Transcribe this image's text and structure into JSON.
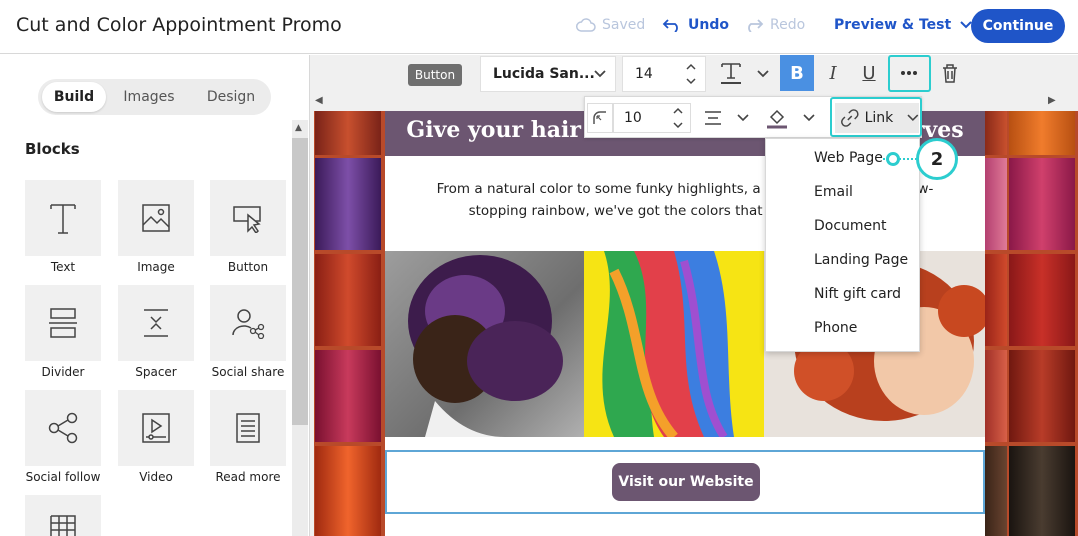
{
  "header": {
    "title": "Cut and Color Appointment Promo",
    "saved_label": "Saved",
    "undo_label": "Undo",
    "redo_label": "Redo",
    "preview_label": "Preview & Test",
    "continue_label": "Continue"
  },
  "left_panel": {
    "tabs": [
      {
        "label": "Build",
        "active": true
      },
      {
        "label": "Images",
        "active": false
      },
      {
        "label": "Design",
        "active": false
      }
    ],
    "blocks_title": "Blocks",
    "blocks": [
      {
        "label": "Text",
        "icon": "text-icon"
      },
      {
        "label": "Image",
        "icon": "image-icon"
      },
      {
        "label": "Button",
        "icon": "button-icon"
      },
      {
        "label": "Divider",
        "icon": "divider-icon"
      },
      {
        "label": "Spacer",
        "icon": "spacer-icon"
      },
      {
        "label": "Social share",
        "icon": "social-share-icon"
      },
      {
        "label": "Social follow",
        "icon": "social-follow-icon"
      },
      {
        "label": "Video",
        "icon": "video-icon"
      },
      {
        "label": "Read more",
        "icon": "read-more-icon"
      },
      {
        "label": "",
        "icon": "table-icon"
      }
    ]
  },
  "toolbar": {
    "element_type": "Button",
    "font": "Lucida San...",
    "font_size": "14"
  },
  "toolbar2": {
    "padding": "10",
    "link_label": "Link"
  },
  "link_menu": {
    "items": [
      "Web Page",
      "Email",
      "Document",
      "Landing Page",
      "Nift gift card",
      "Phone"
    ]
  },
  "callout": {
    "number": "2"
  },
  "email": {
    "headline": "Give your hair the transformation it deserves",
    "body": "From a natural color to some funky highlights, a bold new look or a show-stopping rainbow, we've got the colors that let your style shine!",
    "body_visible": "From a natural color to some funky highlights, a ______ show-stopping rainbow, we've got the colors that let ______!",
    "button_label": "Visit our Website"
  },
  "colors": {
    "accent": "#1f55c8",
    "teal": "#2ccdcf",
    "email_header": "#6c5671"
  }
}
